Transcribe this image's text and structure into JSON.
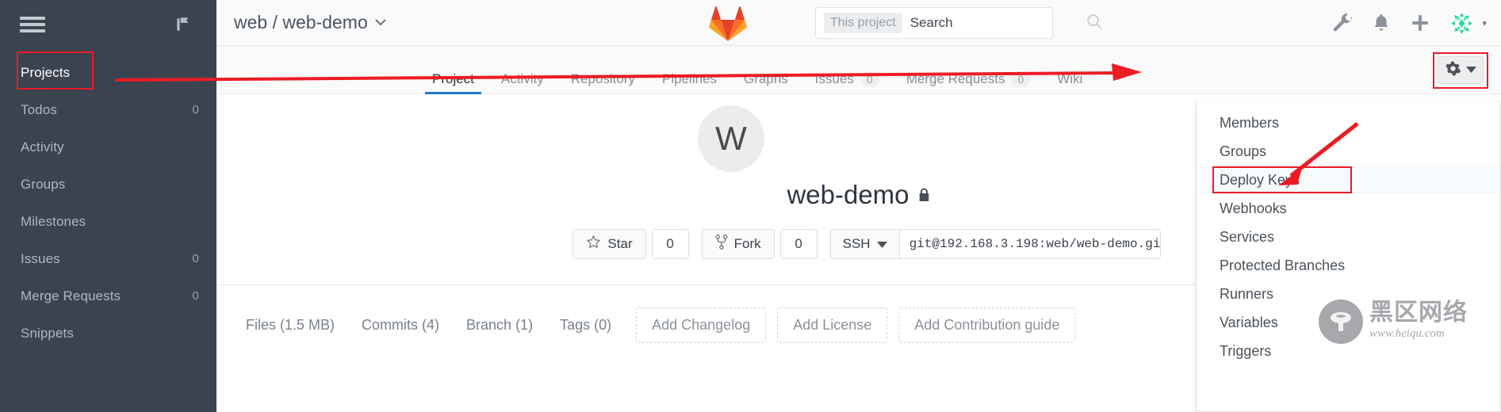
{
  "sidebar": {
    "hamburger_icon": "hamburger-menu-icon",
    "pin_icon": "pin-icon",
    "items": [
      {
        "label": "Projects",
        "count": "",
        "active": true
      },
      {
        "label": "Todos",
        "count": "0",
        "active": false
      },
      {
        "label": "Activity",
        "count": "",
        "active": false
      },
      {
        "label": "Groups",
        "count": "",
        "active": false
      },
      {
        "label": "Milestones",
        "count": "",
        "active": false
      },
      {
        "label": "Issues",
        "count": "0",
        "active": false
      },
      {
        "label": "Merge Requests",
        "count": "0",
        "active": false
      },
      {
        "label": "Snippets",
        "count": "",
        "active": false
      }
    ]
  },
  "header": {
    "breadcrumb": "web / web-demo",
    "caret": "⌄",
    "logo_icon": "gitlab-tanuki-logo",
    "search": {
      "scope": "This project",
      "placeholder": "Search",
      "value": "",
      "icon": "search-icon"
    },
    "icons": [
      {
        "name": "wrench-icon"
      },
      {
        "name": "bell-icon"
      },
      {
        "name": "plus-icon"
      }
    ],
    "avatar_icon": "user-avatar",
    "avatar_caret": "▾"
  },
  "nav": {
    "tabs": [
      {
        "label": "Project",
        "badge": "",
        "active": true
      },
      {
        "label": "Activity",
        "badge": "",
        "active": false
      },
      {
        "label": "Repository",
        "badge": "",
        "active": false
      },
      {
        "label": "Pipelines",
        "badge": "",
        "active": false
      },
      {
        "label": "Graphs",
        "badge": "",
        "active": false
      },
      {
        "label": "Issues",
        "badge": "0",
        "active": false
      },
      {
        "label": "Merge Requests",
        "badge": "0",
        "active": false
      },
      {
        "label": "Wiki",
        "badge": "",
        "active": false
      }
    ],
    "settings_button": {
      "icon": "gear-icon",
      "caret": "▾"
    }
  },
  "settings_menu": {
    "items": [
      {
        "label": "Members",
        "highlighted": false
      },
      {
        "label": "Groups",
        "highlighted": false
      },
      {
        "label": "Deploy Keys",
        "highlighted": true
      },
      {
        "label": "Webhooks",
        "highlighted": false
      },
      {
        "label": "Services",
        "highlighted": false
      },
      {
        "label": "Protected Branches",
        "highlighted": false
      },
      {
        "label": "Runners",
        "highlighted": false
      },
      {
        "label": "Variables",
        "highlighted": false
      },
      {
        "label": "Triggers",
        "highlighted": false
      }
    ]
  },
  "project": {
    "avatar_letter": "W",
    "name": "web-demo",
    "visibility_icon": "lock-icon",
    "star": {
      "label": "Star",
      "icon": "star-icon",
      "count": "0"
    },
    "fork": {
      "label": "Fork",
      "icon": "fork-icon",
      "count": "0"
    },
    "clone": {
      "protocol": "SSH",
      "caret": "▾",
      "url": "git@192.168.3.198:web/web-demo.gi"
    },
    "stats": [
      {
        "label": "Files (1.5 MB)"
      },
      {
        "label": "Commits (4)"
      },
      {
        "label": "Branch (1)"
      },
      {
        "label": "Tags (0)"
      }
    ],
    "add_buttons": [
      {
        "label": "Add Changelog"
      },
      {
        "label": "Add License"
      },
      {
        "label": "Add Contribution guide"
      }
    ]
  },
  "annotations": {
    "color": "#ec1c24",
    "arrow_to_gear": "horizontal-red-arrow",
    "arrow_to_deploy_keys": "diagonal-red-arrow",
    "box_projects": "red-rectangle",
    "box_gear": "red-rectangle",
    "box_deploy_keys": "red-rectangle"
  },
  "watermark": {
    "cn": "黑区网络",
    "en": "www.heiqu.com",
    "logo_icon": "mushroom-icon"
  }
}
